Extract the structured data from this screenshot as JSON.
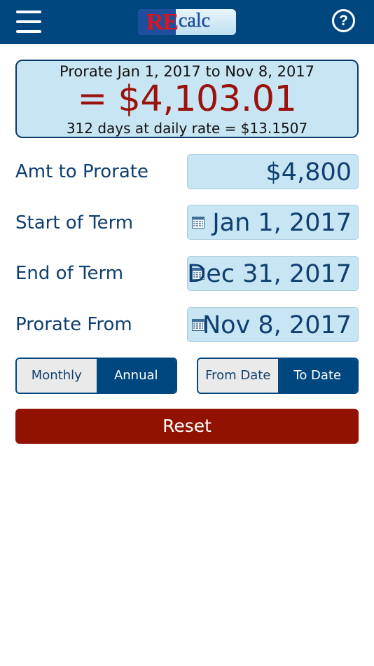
{
  "header": {
    "logo_re": "RE",
    "logo_calc": "calc",
    "help_label": "?"
  },
  "result": {
    "title": "Prorate Jan 1, 2017 to Nov 8, 2017",
    "amount": "= $4,103.01",
    "detail": "312 days at daily rate = $13.1507"
  },
  "fields": {
    "amount": {
      "label": "Amt to Prorate",
      "value": "$4,800"
    },
    "start": {
      "label": "Start of Term",
      "value": "Jan 1, 2017"
    },
    "end": {
      "label": "End of Term",
      "value": "Dec 31, 2017"
    },
    "prorate_from": {
      "label": "Prorate From",
      "value": "Nov 8, 2017"
    }
  },
  "period_toggle": {
    "options": [
      "Monthly",
      "Annual"
    ],
    "selected": "Annual"
  },
  "direction_toggle": {
    "options": [
      "From Date",
      "To Date"
    ],
    "selected": "To Date"
  },
  "reset_label": "Reset",
  "colors": {
    "header": "#00467f",
    "result_bg": "#c8e5f3",
    "amount_text": "#9a120c",
    "label_text": "#0f3f70",
    "reset_bg": "#911200"
  },
  "icons": {
    "menu": "hamburger-menu-icon",
    "help": "question-circle-icon",
    "calendar": "calendar-icon"
  }
}
